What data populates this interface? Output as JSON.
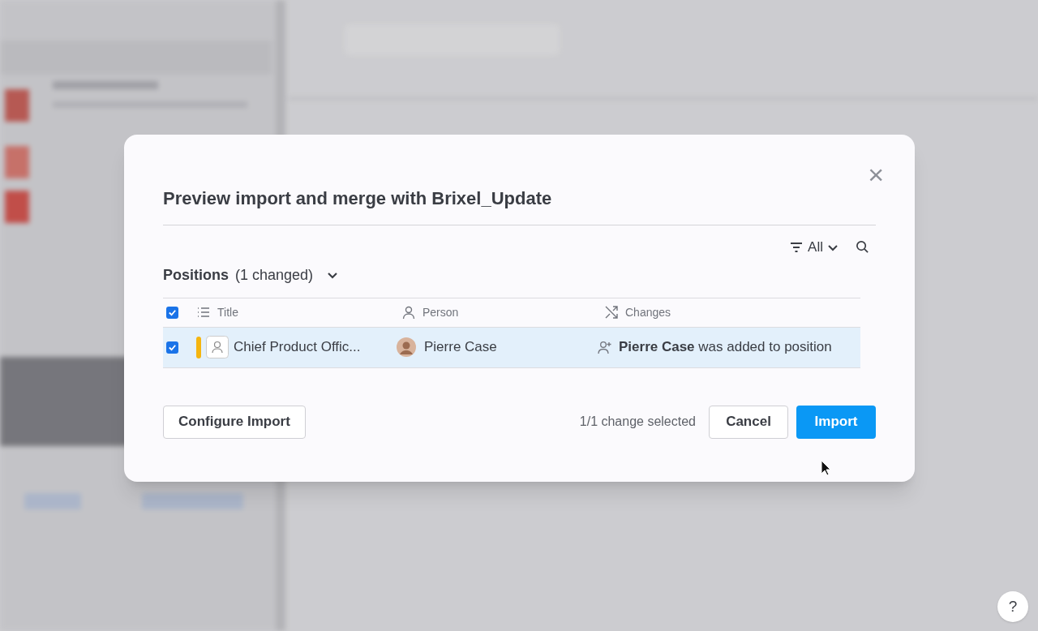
{
  "dialog": {
    "title": "Preview import and merge with Brixel_Update",
    "close": "×"
  },
  "filter": {
    "label": "All"
  },
  "section": {
    "title": "Positions",
    "count": "(1 changed)",
    "expanded": true
  },
  "table": {
    "all_checked": true,
    "columns": [
      {
        "label": "Title",
        "kind": "list"
      },
      {
        "label": "Person",
        "kind": "person"
      },
      {
        "label": "Changes",
        "kind": "shuffle"
      }
    ],
    "rows": [
      {
        "checked": true,
        "selected": true,
        "color": "#f5b50f",
        "title": "Chief Product Offic...",
        "person": "Pierre Case",
        "change": "**Pierre Case** was added to position"
      }
    ]
  },
  "footer": {
    "configure": "Configure Import",
    "summary": "1/1 change selected",
    "cancel": "Cancel",
    "import": "Import"
  },
  "help": "?"
}
